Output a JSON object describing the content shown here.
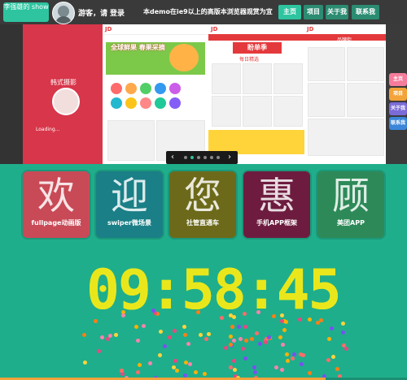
{
  "header": {
    "logo_text": "李强雄的 show",
    "greeting": "游客，请",
    "login_label": "登录",
    "notice": "本demo在ie9以上的高版本浏览器观赏为宜",
    "nav": [
      {
        "label": "主页",
        "active": true
      },
      {
        "label": "项目",
        "active": false
      },
      {
        "label": "关于我",
        "active": false
      },
      {
        "label": "联系我",
        "active": false
      }
    ]
  },
  "slider": {
    "screens": [
      {
        "caption": "韩式摄影",
        "subcaption": "Loading..."
      },
      {
        "logo": "JD",
        "banner": "全球鲜果 春果采摘"
      },
      {
        "logo": "JD",
        "banner": "盼单季",
        "section": "每日精选"
      },
      {
        "logo": "JD",
        "section": "品牌街"
      }
    ],
    "prev_label": "‹",
    "next_label": "›",
    "pagination_count": 6,
    "active_index": 1
  },
  "side_buttons": [
    {
      "label": "主页",
      "color": "#f57c9b"
    },
    {
      "label": "项目",
      "color": "#f2a33a"
    },
    {
      "label": "关于我",
      "color": "#7b6bd8"
    },
    {
      "label": "联系我",
      "color": "#3b86d9"
    }
  ],
  "tiles": [
    {
      "glyph": "欢",
      "caption": "fullpage动画版",
      "color": "#c84a57"
    },
    {
      "glyph": "迎",
      "caption": "swiper微场景",
      "color": "#1a7f86"
    },
    {
      "glyph": "您",
      "caption": "社管直通车",
      "color": "#6c6a1a"
    },
    {
      "glyph": "惠",
      "caption": "手机APP框架",
      "color": "#6d1c3f"
    },
    {
      "glyph": "顾",
      "caption": "美团APP",
      "color": "#2d8a58"
    }
  ],
  "clock": {
    "time": "09:58:45",
    "color": "#e7e51a"
  },
  "colors": {
    "background": "#1fae8b",
    "topbar": "#3a3a3a",
    "accent": "#2ec4a0"
  },
  "progress": 0.8
}
